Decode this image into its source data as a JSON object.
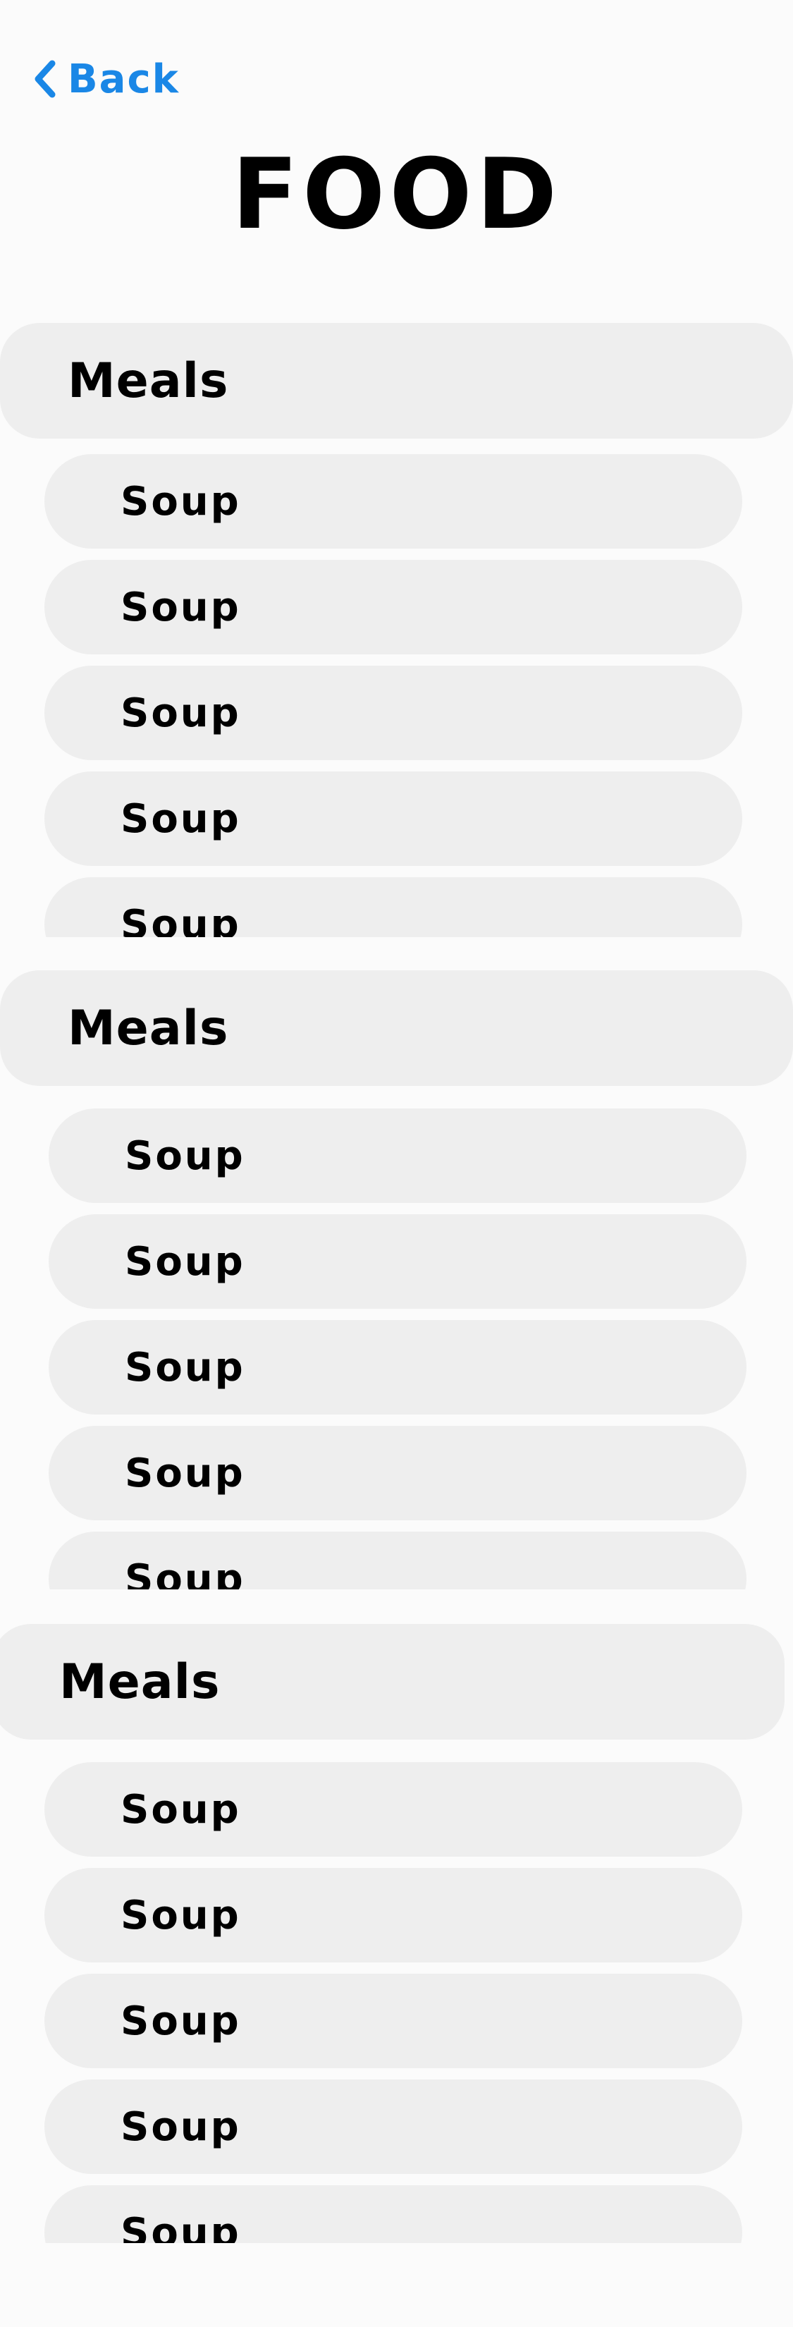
{
  "nav": {
    "back_label": "Back",
    "back_icon": "chevron-left-icon",
    "accent_color": "#1a87e6"
  },
  "page": {
    "title": "FOOD"
  },
  "groups": [
    {
      "label": "Meals",
      "items": [
        {
          "label": "Soup"
        },
        {
          "label": "Soup"
        },
        {
          "label": "Soup"
        },
        {
          "label": "Soup"
        },
        {
          "label": "Soup"
        }
      ]
    },
    {
      "label": "Meals",
      "items": [
        {
          "label": "Soup"
        },
        {
          "label": "Soup"
        },
        {
          "label": "Soup"
        },
        {
          "label": "Soup"
        },
        {
          "label": "Soup"
        }
      ]
    },
    {
      "label": "Meals",
      "items": [
        {
          "label": "Soup"
        },
        {
          "label": "Soup"
        },
        {
          "label": "Soup"
        },
        {
          "label": "Soup"
        },
        {
          "label": "Soup"
        }
      ]
    }
  ]
}
